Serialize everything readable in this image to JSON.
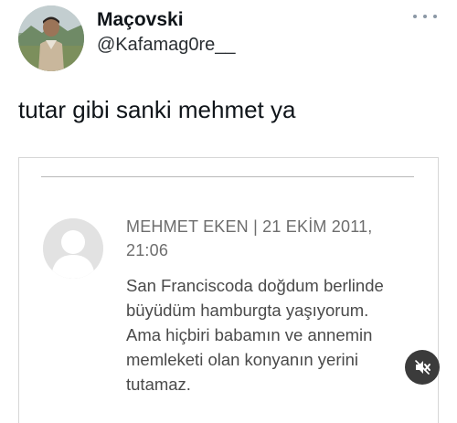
{
  "tweet": {
    "author": {
      "display_name": "Maçovski",
      "handle": "@Kafamag0re__",
      "avatar_icon": "profile-photo"
    },
    "text": "tutar gibi sanki mehmet ya",
    "more_icon": "more-horizontal-icon"
  },
  "quoted_image": {
    "comment": {
      "meta_line1": "MEHMET EKEN | 21 EKİM 2011,",
      "meta_line2": "21:06",
      "body_lines": [
        "San Franciscoda doğdum berlinde",
        "büyüdüm hamburgta yaşıyorum.",
        "Ama hiçbiri babamın ve annemin",
        "memleketi olan konyanın yerini",
        "tutamaz."
      ],
      "avatar_icon": "default-user-icon"
    }
  },
  "media_controls": {
    "mute_icon": "muted-speaker-icon"
  },
  "colors": {
    "meta_text": "#6d6d6d",
    "body_text": "#4a4a4a",
    "mute_button_bg": "#3b3b3b"
  }
}
